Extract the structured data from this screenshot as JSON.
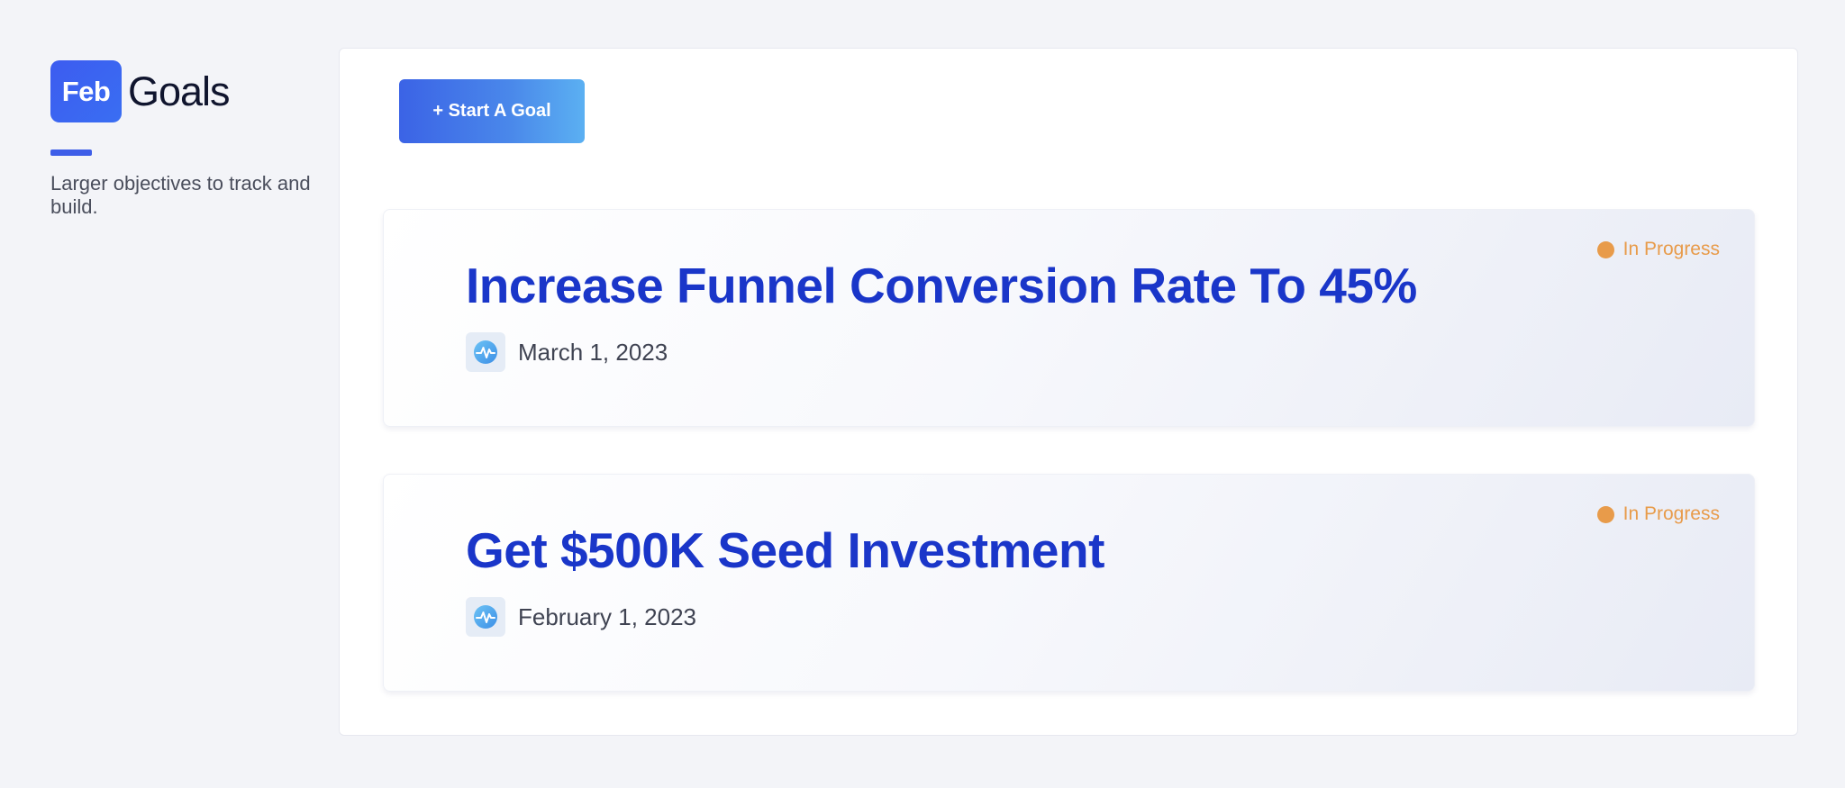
{
  "sidebar": {
    "logo_badge": "Feb",
    "logo_title": "Goals",
    "tagline": "Larger objectives to track and build."
  },
  "toolbar": {
    "start_goal_label": "+ Start A Goal"
  },
  "goals": [
    {
      "title": "Increase Funnel Conversion Rate To 45%",
      "date": "March 1, 2023",
      "status": "In Progress",
      "icon": "activity-pulse-icon"
    },
    {
      "title": "Get $500K Seed Investment",
      "date": "February 1, 2023",
      "status": "In Progress",
      "icon": "activity-pulse-icon"
    }
  ],
  "colors": {
    "accent": "#3e5ee8",
    "title_blue": "#1a36c9",
    "status_orange": "#e89b4a",
    "background": "#f3f4f8"
  }
}
